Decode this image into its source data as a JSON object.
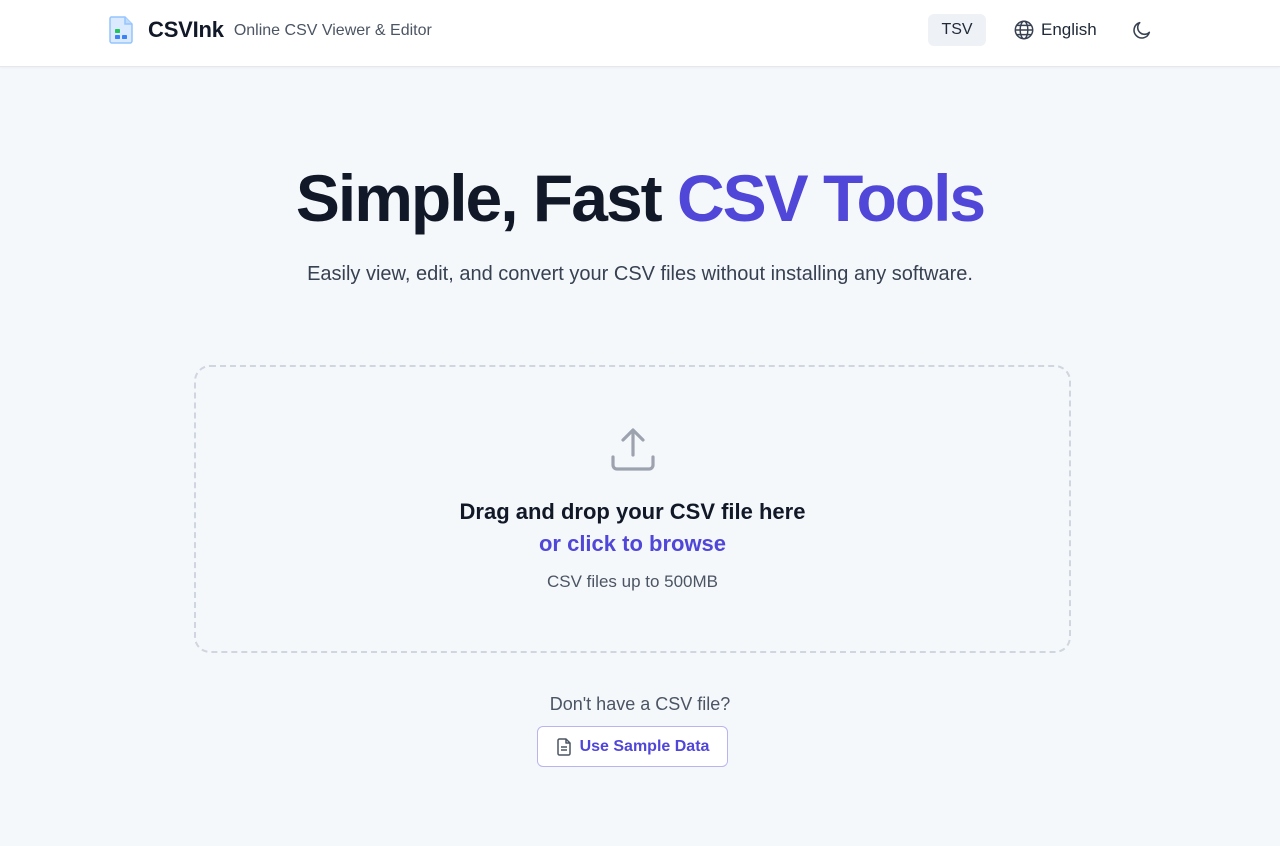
{
  "header": {
    "brand_name": "CSVInk",
    "brand_tagline": "Online CSV Viewer & Editor",
    "tsv_label": "TSV",
    "language_label": "English",
    "icons": {
      "logo": "csv-file-logo-icon",
      "language": "globe-icon",
      "theme": "moon-icon"
    }
  },
  "hero": {
    "title_main": "Simple, Fast ",
    "title_accent": "CSV Tools",
    "subtitle": "Easily view, edit, and convert your CSV files without installing any software."
  },
  "dropzone": {
    "title": "Drag and drop your CSV file here",
    "browse_label": "or click to browse",
    "hint": "CSV files up to 500MB",
    "icon": "upload-icon"
  },
  "sample": {
    "question": "Don't have a CSV file?",
    "button_label": "Use Sample Data",
    "icon": "document-icon"
  },
  "colors": {
    "accent": "#5046d8",
    "background": "#f5f8fb",
    "header_bg": "#ffffff",
    "text_primary": "#111827",
    "text_secondary": "#4b5563"
  }
}
